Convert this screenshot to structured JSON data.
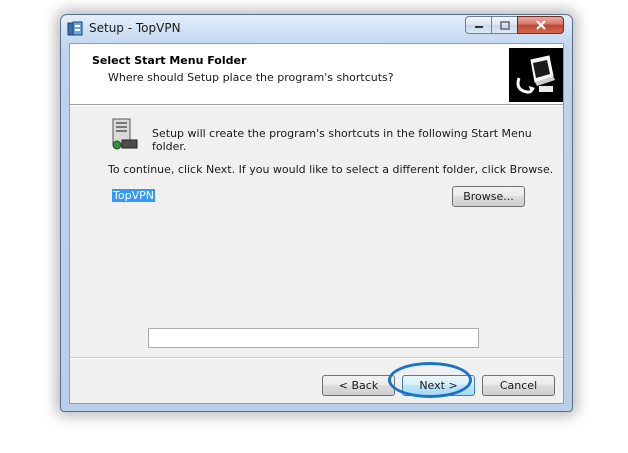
{
  "window": {
    "title": "Setup - TopVPN"
  },
  "header": {
    "title": "Select Start Menu Folder",
    "subtitle": "Where should Setup place the program's shortcuts?"
  },
  "content": {
    "info_line": "Setup will create the program's shortcuts in the following Start Menu folder.",
    "instruction": "To continue, click Next. If you would like to select a different folder, click Browse.",
    "folder_value": "TopVPN",
    "browse_label": "Browse..."
  },
  "footer": {
    "back_label": "< Back",
    "next_label": "Next >",
    "cancel_label": "Cancel"
  },
  "colors": {
    "highlight": "#1a73c8",
    "selection": "#3399ff"
  },
  "icons": {
    "app": "setup-app-icon",
    "header": "computer-install-icon",
    "folder": "start-menu-folder-icon"
  }
}
